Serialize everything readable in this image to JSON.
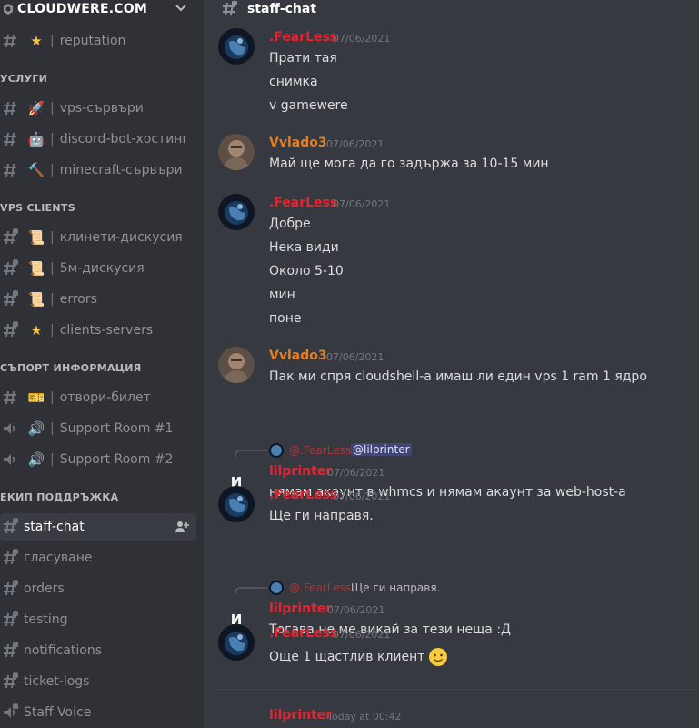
{
  "server": {
    "name": "CLOUDWERE.COM"
  },
  "sidebar": {
    "items": [
      {
        "kind": "channel",
        "icon": "text-channel-icon",
        "emoji": "★",
        "emoji_color": "#f5c33b",
        "label": "reputation"
      },
      {
        "kind": "section",
        "label": "УСЛУГИ"
      },
      {
        "kind": "channel",
        "icon": "text-channel-icon",
        "emoji": "🚀",
        "label": "vps-сървъри"
      },
      {
        "kind": "channel",
        "icon": "text-channel-icon",
        "emoji": "🤖",
        "label": "discord-bot-хостинг"
      },
      {
        "kind": "channel",
        "icon": "text-channel-icon",
        "emoji": "🔨",
        "label": "minecraft-сървъри"
      },
      {
        "kind": "section",
        "label": "VPS CLIENTS"
      },
      {
        "kind": "channel",
        "icon": "locked-text-channel-icon",
        "emoji": "📜",
        "label": "клинети-дискусия"
      },
      {
        "kind": "channel",
        "icon": "locked-text-channel-icon",
        "emoji": "📜",
        "label": "5м-дискусия"
      },
      {
        "kind": "channel",
        "icon": "locked-text-channel-icon",
        "emoji": "📜",
        "label": "errors"
      },
      {
        "kind": "channel",
        "icon": "locked-text-channel-icon",
        "emoji": "★",
        "emoji_color": "#f5c33b",
        "label": "clients-servers"
      },
      {
        "kind": "section",
        "label": "СЪПОРТ ИНФОРМАЦИЯ"
      },
      {
        "kind": "channel",
        "icon": "text-channel-icon",
        "emoji": "🎫",
        "label": "отвори-билет"
      },
      {
        "kind": "channel",
        "icon": "voice-channel-icon",
        "emoji": "🔊",
        "label": "Support Room #1"
      },
      {
        "kind": "channel",
        "icon": "voice-channel-icon",
        "emoji": "🔊",
        "label": "Support Room #2"
      },
      {
        "kind": "section",
        "label": "ЕКИП ПОДДРЪЖКА"
      },
      {
        "kind": "channel",
        "icon": "locked-text-channel-icon",
        "label": "staff-chat",
        "active": true
      },
      {
        "kind": "channel",
        "icon": "locked-text-channel-icon",
        "label": "гласуване"
      },
      {
        "kind": "channel",
        "icon": "locked-text-channel-icon",
        "label": "orders"
      },
      {
        "kind": "channel",
        "icon": "locked-text-channel-icon",
        "label": "testing"
      },
      {
        "kind": "channel",
        "icon": "locked-text-channel-icon",
        "label": "notifications"
      },
      {
        "kind": "channel",
        "icon": "locked-text-channel-icon",
        "label": "ticket-logs"
      },
      {
        "kind": "channel",
        "icon": "locked-voice-channel-icon",
        "label": "Staff Voice"
      }
    ]
  },
  "channel": {
    "title": "staff-chat"
  },
  "colors": {
    "fearless": "#e8232f",
    "vvlado": "#e67e22",
    "lilprinter": "#e8232f",
    "reply_name": "#b1343a"
  },
  "messages": [
    {
      "author": ".FearLess",
      "author_color": "#e8232f",
      "avatar": "globe",
      "time": "07/06/2021",
      "lines": [
        "Прати тая",
        "снимка",
        "v gamewere"
      ]
    },
    {
      "author": "Vvlado3",
      "author_color": "#e67e22",
      "avatar": "photo",
      "time": "07/06/2021",
      "lines": [
        "Май ще мога да го задържа за 10-15 мин"
      ]
    },
    {
      "author": ".FearLess",
      "author_color": "#e8232f",
      "avatar": "globe",
      "time": "07/06/2021",
      "lines": [
        "Добре",
        "Нека види",
        "Около 5-10",
        "мин",
        "поне"
      ]
    },
    {
      "author": "Vvlado3",
      "author_color": "#e67e22",
      "avatar": "photo",
      "time": "07/06/2021",
      "lines": [
        "Пак ми спря cloudshell-а имаш ли един vps 1 ram 1 ядро"
      ]
    },
    {
      "author": "lilprinter",
      "author_color": "#e8232f",
      "avatar": "И",
      "time": "07/06/2021",
      "reply": {
        "name": "@.FearLess",
        "mention": "@lilprinter"
      },
      "lines": [
        "нямам акаунт в whmcs и нямам акаунт за web-host-а"
      ]
    },
    {
      "author": ".FearLess",
      "author_color": "#e8232f",
      "avatar": "globe",
      "time": "07/06/2021",
      "lines": [
        "Ще ги направя."
      ]
    },
    {
      "author": "lilprinter",
      "author_color": "#e8232f",
      "avatar": "И",
      "time": "07/06/2021",
      "reply": {
        "name": "@.FearLess",
        "text": "Ще ги направя."
      },
      "lines": [
        "Тогава не ме викай за тези неща :Д"
      ]
    },
    {
      "author": ".FearLess",
      "author_color": "#e8232f",
      "avatar": "globe",
      "time": "07/06/2021",
      "lines": [
        "Още 1 щастлив клиент"
      ],
      "trailing_emoji": "slightly-smiling-face"
    },
    {
      "author": "lilprinter",
      "author_color": "#e8232f",
      "avatar": "И",
      "time": "Today at 00:42",
      "lines": []
    }
  ]
}
